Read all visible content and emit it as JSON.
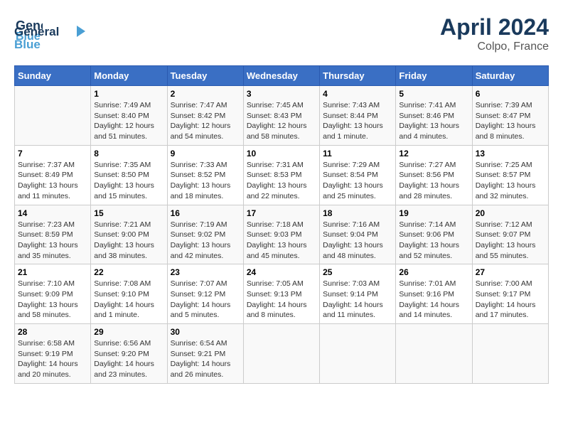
{
  "header": {
    "logo_line1": "General",
    "logo_line2": "Blue",
    "title": "April 2024",
    "subtitle": "Colpo, France"
  },
  "columns": [
    "Sunday",
    "Monday",
    "Tuesday",
    "Wednesday",
    "Thursday",
    "Friday",
    "Saturday"
  ],
  "weeks": [
    [
      {
        "day": "",
        "info": ""
      },
      {
        "day": "1",
        "info": "Sunrise: 7:49 AM\nSunset: 8:40 PM\nDaylight: 12 hours\nand 51 minutes."
      },
      {
        "day": "2",
        "info": "Sunrise: 7:47 AM\nSunset: 8:42 PM\nDaylight: 12 hours\nand 54 minutes."
      },
      {
        "day": "3",
        "info": "Sunrise: 7:45 AM\nSunset: 8:43 PM\nDaylight: 12 hours\nand 58 minutes."
      },
      {
        "day": "4",
        "info": "Sunrise: 7:43 AM\nSunset: 8:44 PM\nDaylight: 13 hours\nand 1 minute."
      },
      {
        "day": "5",
        "info": "Sunrise: 7:41 AM\nSunset: 8:46 PM\nDaylight: 13 hours\nand 4 minutes."
      },
      {
        "day": "6",
        "info": "Sunrise: 7:39 AM\nSunset: 8:47 PM\nDaylight: 13 hours\nand 8 minutes."
      }
    ],
    [
      {
        "day": "7",
        "info": "Sunrise: 7:37 AM\nSunset: 8:49 PM\nDaylight: 13 hours\nand 11 minutes."
      },
      {
        "day": "8",
        "info": "Sunrise: 7:35 AM\nSunset: 8:50 PM\nDaylight: 13 hours\nand 15 minutes."
      },
      {
        "day": "9",
        "info": "Sunrise: 7:33 AM\nSunset: 8:52 PM\nDaylight: 13 hours\nand 18 minutes."
      },
      {
        "day": "10",
        "info": "Sunrise: 7:31 AM\nSunset: 8:53 PM\nDaylight: 13 hours\nand 22 minutes."
      },
      {
        "day": "11",
        "info": "Sunrise: 7:29 AM\nSunset: 8:54 PM\nDaylight: 13 hours\nand 25 minutes."
      },
      {
        "day": "12",
        "info": "Sunrise: 7:27 AM\nSunset: 8:56 PM\nDaylight: 13 hours\nand 28 minutes."
      },
      {
        "day": "13",
        "info": "Sunrise: 7:25 AM\nSunset: 8:57 PM\nDaylight: 13 hours\nand 32 minutes."
      }
    ],
    [
      {
        "day": "14",
        "info": "Sunrise: 7:23 AM\nSunset: 8:59 PM\nDaylight: 13 hours\nand 35 minutes."
      },
      {
        "day": "15",
        "info": "Sunrise: 7:21 AM\nSunset: 9:00 PM\nDaylight: 13 hours\nand 38 minutes."
      },
      {
        "day": "16",
        "info": "Sunrise: 7:19 AM\nSunset: 9:02 PM\nDaylight: 13 hours\nand 42 minutes."
      },
      {
        "day": "17",
        "info": "Sunrise: 7:18 AM\nSunset: 9:03 PM\nDaylight: 13 hours\nand 45 minutes."
      },
      {
        "day": "18",
        "info": "Sunrise: 7:16 AM\nSunset: 9:04 PM\nDaylight: 13 hours\nand 48 minutes."
      },
      {
        "day": "19",
        "info": "Sunrise: 7:14 AM\nSunset: 9:06 PM\nDaylight: 13 hours\nand 52 minutes."
      },
      {
        "day": "20",
        "info": "Sunrise: 7:12 AM\nSunset: 9:07 PM\nDaylight: 13 hours\nand 55 minutes."
      }
    ],
    [
      {
        "day": "21",
        "info": "Sunrise: 7:10 AM\nSunset: 9:09 PM\nDaylight: 13 hours\nand 58 minutes."
      },
      {
        "day": "22",
        "info": "Sunrise: 7:08 AM\nSunset: 9:10 PM\nDaylight: 14 hours\nand 1 minute."
      },
      {
        "day": "23",
        "info": "Sunrise: 7:07 AM\nSunset: 9:12 PM\nDaylight: 14 hours\nand 5 minutes."
      },
      {
        "day": "24",
        "info": "Sunrise: 7:05 AM\nSunset: 9:13 PM\nDaylight: 14 hours\nand 8 minutes."
      },
      {
        "day": "25",
        "info": "Sunrise: 7:03 AM\nSunset: 9:14 PM\nDaylight: 14 hours\nand 11 minutes."
      },
      {
        "day": "26",
        "info": "Sunrise: 7:01 AM\nSunset: 9:16 PM\nDaylight: 14 hours\nand 14 minutes."
      },
      {
        "day": "27",
        "info": "Sunrise: 7:00 AM\nSunset: 9:17 PM\nDaylight: 14 hours\nand 17 minutes."
      }
    ],
    [
      {
        "day": "28",
        "info": "Sunrise: 6:58 AM\nSunset: 9:19 PM\nDaylight: 14 hours\nand 20 minutes."
      },
      {
        "day": "29",
        "info": "Sunrise: 6:56 AM\nSunset: 9:20 PM\nDaylight: 14 hours\nand 23 minutes."
      },
      {
        "day": "30",
        "info": "Sunrise: 6:54 AM\nSunset: 9:21 PM\nDaylight: 14 hours\nand 26 minutes."
      },
      {
        "day": "",
        "info": ""
      },
      {
        "day": "",
        "info": ""
      },
      {
        "day": "",
        "info": ""
      },
      {
        "day": "",
        "info": ""
      }
    ]
  ]
}
